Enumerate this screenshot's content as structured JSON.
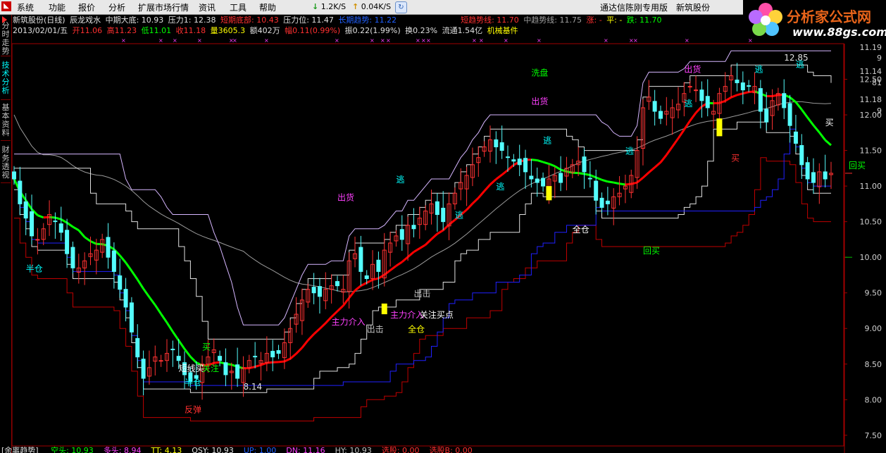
{
  "menu": {
    "items": [
      "系统",
      "功能",
      "报价",
      "分析",
      "扩展市场行情",
      "资讯",
      "工具",
      "帮助"
    ],
    "speed_down": "1.2K/S",
    "speed_up": "0.04K/S",
    "right_items": [
      "通达信陈刚专用版",
      "新筑股份"
    ]
  },
  "brand": {
    "name": "分析家公式网",
    "url": "www.88gs.com"
  },
  "side_tabs": [
    "分时走势",
    "技术分析",
    "基本资料",
    "财务透视"
  ],
  "info_line1": {
    "stock": "新筑股份(日线)",
    "formula": "辰龙戏水",
    "mid_bottom": "中期大底: 10.93",
    "pressure1": "压力1: 12.38",
    "short_bottom": "短期底部: 10.43",
    "pressure_pos": "压力位: 11.47",
    "long_line": "长期趋势: 11.22",
    "short_trend": "短趋势线: 11.70",
    "mid_trend": "中趋势线: 11.75",
    "rise": "涨: -",
    "flat": "平: -",
    "fall": "跌: 11.70"
  },
  "info_line2": {
    "date": "2013/02/01/五",
    "open": "开11.06",
    "high": "高11.23",
    "low": "低11.01",
    "close": "收11.18",
    "volume": "量3605.3",
    "amount": "额402万",
    "change": "幅0.11(0.99%)",
    "amplitude": "振0.22(1.99%)",
    "turnover": "换0.23%",
    "float": "流通1.54亿",
    "sector": "机械基件"
  },
  "colors": {
    "up": "#ff3232",
    "down": "#54fcfc",
    "green_line": "#00ff00",
    "red_line": "#ff0000",
    "box": "#e0e0e0",
    "lavender": "#d6b6ff",
    "blue": "#2020ff",
    "gray": "#9a9a9a",
    "dark_red": "#c00000"
  },
  "chart_data": {
    "type": "candlestick",
    "ylim": [
      7.35,
      12.98
    ],
    "y_ticks": [
      {
        "v": 12.5,
        "label": "12.50"
      },
      {
        "v": 12.0,
        "label": "12.00"
      },
      {
        "v": 11.5,
        "label": "11.50"
      },
      {
        "v": 11.0,
        "label": "11.00"
      },
      {
        "v": 10.5,
        "label": "10.50"
      },
      {
        "v": 10.0,
        "label": "10.00"
      },
      {
        "v": 9.5,
        "label": "9.50"
      },
      {
        "v": 9.0,
        "label": "9.00"
      },
      {
        "v": 8.5,
        "label": "8.50"
      },
      {
        "v": 8.0,
        "label": "8.00"
      },
      {
        "v": 7.5,
        "label": "7.50"
      }
    ],
    "small_scale": [
      "11.19",
      "9",
      "11.14",
      "81",
      "11.18",
      "9"
    ],
    "close": [
      11.1,
      10.75,
      10.55,
      10.3,
      10.25,
      10.4,
      10.6,
      10.5,
      10.35,
      10.05,
      9.85,
      9.85,
      9.95,
      10.05,
      10.1,
      10.25,
      10.0,
      9.8,
      9.55,
      9.3,
      8.95,
      8.6,
      8.3,
      8.45,
      8.6,
      8.55,
      8.65,
      8.7,
      8.55,
      8.35,
      8.25,
      8.3,
      8.5,
      8.6,
      8.7,
      8.55,
      8.35,
      8.4,
      8.3,
      8.45,
      8.55,
      8.6,
      8.55,
      8.65,
      8.6,
      8.65,
      8.8,
      9.0,
      9.2,
      9.4,
      9.55,
      9.5,
      9.45,
      9.55,
      9.6,
      9.6,
      9.55,
      9.95,
      10.05,
      9.8,
      9.7,
      9.9,
      9.8,
      10.1,
      10.2,
      10.3,
      10.25,
      10.45,
      10.4,
      10.55,
      10.65,
      10.75,
      10.6,
      10.5,
      10.75,
      10.9,
      11.05,
      11.15,
      11.3,
      11.4,
      11.55,
      11.65,
      11.55,
      11.5,
      11.4,
      11.35,
      11.3,
      11.2,
      11.1,
      11.05,
      11.0,
      11.1,
      11.15,
      11.05,
      11.25,
      11.3,
      11.35,
      11.2,
      11.1,
      10.8,
      10.7,
      10.75,
      10.85,
      10.9,
      11.0,
      11.15,
      11.5,
      12.1,
      12.25,
      12.05,
      11.95,
      12.05,
      12.1,
      12.15,
      12.3,
      12.4,
      12.35,
      12.2,
      12.1,
      12.05,
      12.3,
      12.4,
      12.55,
      12.45,
      12.35,
      12.4,
      12.4,
      12.05,
      11.9,
      12.2,
      12.3,
      12.1,
      11.85,
      11.6,
      11.3,
      11.1,
      11.05,
      11.2,
      11.1,
      11.18
    ],
    "annotations": [
      {
        "text": "半仓",
        "i": 2,
        "v": 9.8,
        "color": "#00ffff"
      },
      {
        "text": "短线买",
        "i": 28,
        "v": 8.4,
        "color": "#ffffff"
      },
      {
        "text": "关注",
        "i": 32,
        "v": 8.4,
        "color": "#00ff00"
      },
      {
        "text": "买",
        "i": 32,
        "v": 8.7,
        "color": "#00ff00"
      },
      {
        "text": "半仓",
        "i": 29,
        "v": 8.2,
        "color": "#00ffff"
      },
      {
        "text": "反弹",
        "i": 29,
        "v": 7.82,
        "color": "#ff3030"
      },
      {
        "text": "8.14",
        "i": 39,
        "v": 8.14,
        "color": "#e0e0e0"
      },
      {
        "text": "主力介入",
        "i": 54,
        "v": 9.05,
        "color": "#ff40ff"
      },
      {
        "text": "出击",
        "i": 60,
        "v": 8.95,
        "color": "#c0c0c0"
      },
      {
        "text": "出货",
        "i": 55,
        "v": 10.8,
        "color": "#ff40ff"
      },
      {
        "text": "主力介入",
        "i": 64,
        "v": 9.15,
        "color": "#ff40ff"
      },
      {
        "text": "全仓",
        "i": 67,
        "v": 8.95,
        "color": "#ffff00"
      },
      {
        "text": "关注买点",
        "i": 69,
        "v": 9.15,
        "color": "#ffffff"
      },
      {
        "text": "出击",
        "i": 68,
        "v": 9.45,
        "color": "#c0c0c0"
      },
      {
        "text": "逃",
        "i": 65,
        "v": 11.05,
        "color": "#00ffff"
      },
      {
        "text": "逃",
        "i": 75,
        "v": 10.55,
        "color": "#00ffff"
      },
      {
        "text": "逃",
        "i": 82,
        "v": 10.95,
        "color": "#00ffff"
      },
      {
        "text": "逃",
        "i": 90,
        "v": 11.6,
        "color": "#00ffff"
      },
      {
        "text": "全仓",
        "i": 95,
        "v": 10.35,
        "color": "#ffffff"
      },
      {
        "text": "洗盘",
        "i": 88,
        "v": 12.55,
        "color": "#00ff00"
      },
      {
        "text": "出货",
        "i": 88,
        "v": 12.15,
        "color": "#ff40ff"
      },
      {
        "text": "逃",
        "i": 104,
        "v": 11.45,
        "color": "#00ffff"
      },
      {
        "text": "回买",
        "i": 107,
        "v": 10.05,
        "color": "#00ff00"
      },
      {
        "text": "出货",
        "i": 114,
        "v": 12.6,
        "color": "#ff40ff"
      },
      {
        "text": "逃",
        "i": 114,
        "v": 12.12,
        "color": "#00ffff"
      },
      {
        "text": "买",
        "i": 122,
        "v": 11.35,
        "color": "#ff3030"
      },
      {
        "text": "逃",
        "i": 126,
        "v": 12.6,
        "color": "#00ffff"
      },
      {
        "text": "12.85",
        "i": 131,
        "v": 12.76,
        "color": "#e0e0e0"
      },
      {
        "text": "逃",
        "i": 133,
        "v": 12.67,
        "color": "#00ffff"
      },
      {
        "text": "买",
        "i": 138,
        "v": 11.85,
        "color": "#ffffff"
      },
      {
        "text": "回买",
        "i": 142,
        "v": 11.25,
        "color": "#00ff00"
      }
    ],
    "yellow_bars": [
      {
        "i": 63,
        "lo": 9.2,
        "hi": 9.35
      },
      {
        "i": 91,
        "lo": 10.8,
        "hi": 11.0
      },
      {
        "i": 120,
        "lo": 11.7,
        "hi": 11.95
      }
    ]
  },
  "bottom": {
    "title": "[余离趋势]",
    "items": [
      {
        "text": "空头: 10.93",
        "color": "#00ff00"
      },
      {
        "text": "多头: 8.94",
        "color": "#ff40ff"
      },
      {
        "text": "TT: 4.13",
        "color": "#ffff00"
      },
      {
        "text": "QSY: 10.93",
        "color": "#e0e0e0"
      },
      {
        "text": "UP: 1.00",
        "color": "#2060ff"
      },
      {
        "text": "DN: 11.16",
        "color": "#ff40ff"
      },
      {
        "text": "HY: 10.93",
        "color": "#c0c0c0"
      },
      {
        "text": "选股: 0.00",
        "color": "#ff3030"
      },
      {
        "text": "选股B: 0.00",
        "color": "#ff3030"
      }
    ]
  }
}
